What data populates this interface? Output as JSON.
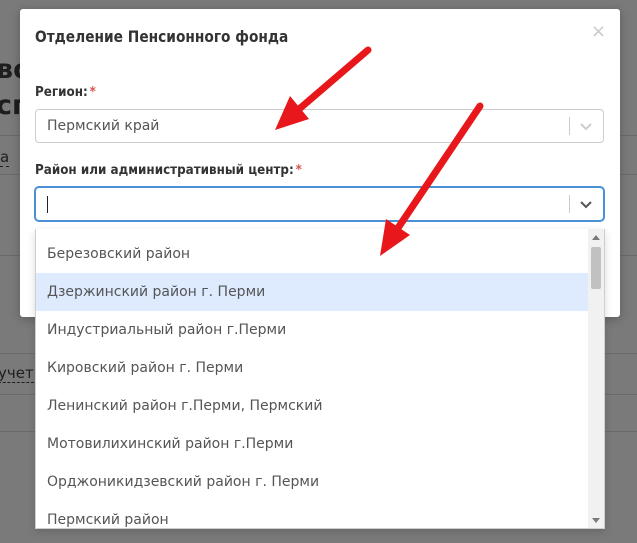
{
  "background": {
    "title_partial": "во\nсп",
    "link_partial_1": "а",
    "link_partial_2": "учет"
  },
  "modal": {
    "title": "Отделение Пенсионного фонда",
    "close_label": "×",
    "region_label": "Регион:",
    "required_mark": "*",
    "region_value": "Пермский край",
    "district_label": "Район или административный центр:",
    "district_value": ""
  },
  "dropdown": {
    "options": [
      "Березовский район",
      "Дзержинский район г. Перми",
      "Индустриальный район г.Перми",
      "Кировский район г. Перми",
      "Ленинский район г.Перми, Пермский",
      "Мотовилихинский район г.Перми",
      "Орджоникидзевский район г. Перми",
      "Пермский район"
    ],
    "highlighted_index": 1
  },
  "colors": {
    "annotation_arrow": "#e8171b",
    "required_star": "#d9534f",
    "highlight": "#deebff",
    "focus_border": "#4a90d9"
  },
  "icons": {
    "close": "close-icon",
    "dropdown": "chevron-down-icon",
    "annotation": "red-arrow-icon"
  }
}
